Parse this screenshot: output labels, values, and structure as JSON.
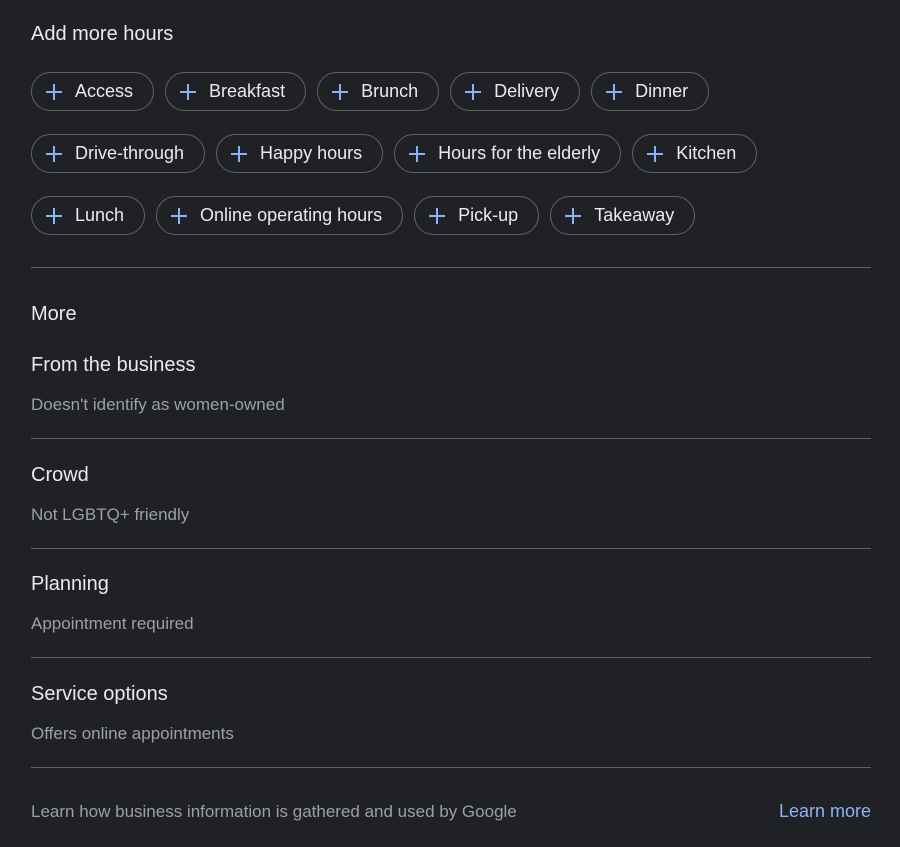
{
  "add_hours": {
    "title": "Add more hours",
    "rows": [
      [
        "Access",
        "Breakfast",
        "Brunch",
        "Delivery",
        "Dinner"
      ],
      [
        "Drive-through",
        "Happy hours",
        "Hours for the elderly",
        "Kitchen"
      ],
      [
        "Lunch",
        "Online operating hours",
        "Pick-up",
        "Takeaway"
      ]
    ]
  },
  "more": {
    "title": "More",
    "sections": [
      {
        "title": "From the business",
        "value": "Doesn't identify as women-owned"
      },
      {
        "title": "Crowd",
        "value": "Not LGBTQ+ friendly"
      },
      {
        "title": "Planning",
        "value": "Appointment required"
      },
      {
        "title": "Service options",
        "value": "Offers online appointments"
      }
    ]
  },
  "footer": {
    "text": "Learn how business information is gathered and used by Google",
    "link": "Learn more"
  },
  "colors": {
    "background": "#202124",
    "accent": "#8ab4f8",
    "text_primary": "#e8eaed",
    "text_secondary": "#9aa0a6",
    "border": "#5f6368"
  },
  "icons": {
    "chip_icon": "plus-icon"
  }
}
